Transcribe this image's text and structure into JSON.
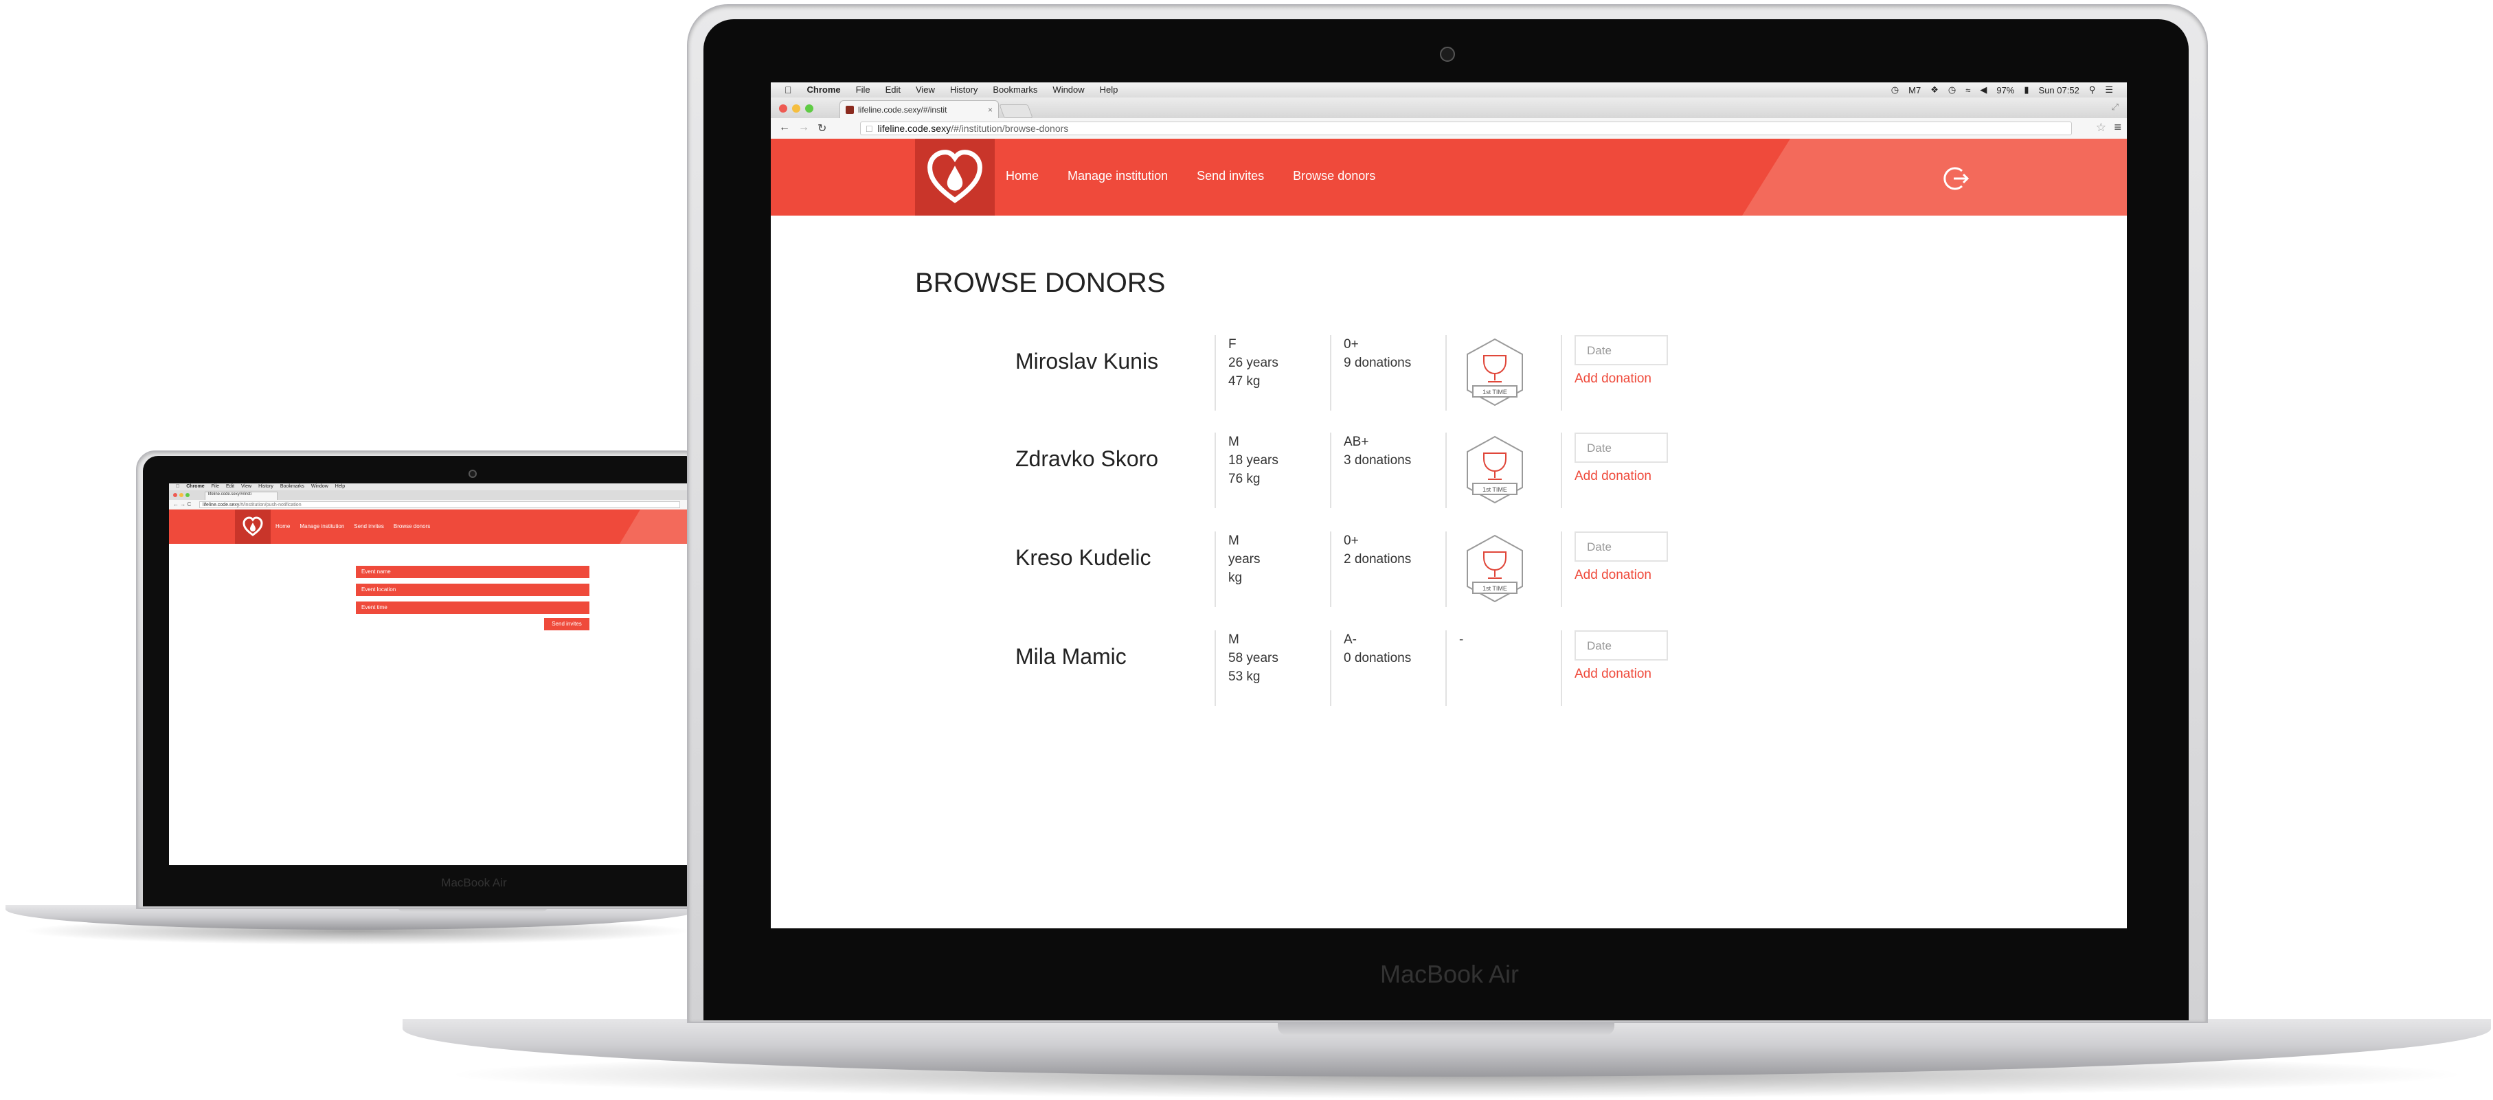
{
  "laptop_big": {
    "brand": "MacBook Air",
    "menubar": {
      "items": [
        "Chrome",
        "File",
        "Edit",
        "View",
        "History",
        "Bookmarks",
        "Window",
        "Help"
      ],
      "status": {
        "badge": "7",
        "battery": "97%",
        "clock": "Sun 07:52"
      }
    },
    "browser": {
      "tab_title": "lifeline.code.sexy/#/instit",
      "url_host": "lifeline.code.sexy",
      "url_path": "/#/institution/browse-donors"
    },
    "app": {
      "nav": [
        "Home",
        "Manage institution",
        "Send invites",
        "Browse donors"
      ],
      "page_title": "BROWSE DONORS",
      "donors": [
        {
          "name": "Miroslav Kunis",
          "sex": "F",
          "age": "26 years",
          "weight": "47 kg",
          "blood_type": "0+",
          "donations": "9 donations",
          "badge_text": "1st TIME",
          "date_placeholder": "Date",
          "add_label": "Add donation"
        },
        {
          "name": "Zdravko Skoro",
          "sex": "M",
          "age": "18 years",
          "weight": "76 kg",
          "blood_type": "AB+",
          "donations": "3 donations",
          "badge_text": "1st TIME",
          "date_placeholder": "Date",
          "add_label": "Add donation"
        },
        {
          "name": "Kreso Kudelic",
          "sex": "M",
          "age": "years",
          "weight": "kg",
          "blood_type": "0+",
          "donations": "2 donations",
          "badge_text": "1st TIME",
          "date_placeholder": "Date",
          "add_label": "Add donation"
        },
        {
          "name": "Mila Mamic",
          "sex": "M",
          "age": "58 years",
          "weight": "53 kg",
          "blood_type": "A-",
          "donations": "0 donations",
          "badge_text": "-",
          "date_placeholder": "Date",
          "add_label": "Add donation"
        }
      ]
    }
  },
  "laptop_small": {
    "brand": "MacBook Air",
    "menubar": {
      "items": [
        "Chrome",
        "File",
        "Edit",
        "View",
        "History",
        "Bookmarks",
        "Window",
        "Help"
      ]
    },
    "browser": {
      "tab_title": "lifeline.code.sexy/#/insti",
      "url_host": "lifeline.code.sexy",
      "url_path": "/#/institution/push-notification"
    },
    "app": {
      "nav": [
        "Home",
        "Manage institution",
        "Send invites",
        "Browse donors"
      ],
      "fields": [
        "Event name",
        "Event location",
        "Event time"
      ],
      "send_label": "Send invites"
    }
  },
  "colors": {
    "brand_red": "#ef4a3b",
    "brand_red_dark": "#c9352a",
    "brand_red_light": "#f36a5b"
  }
}
